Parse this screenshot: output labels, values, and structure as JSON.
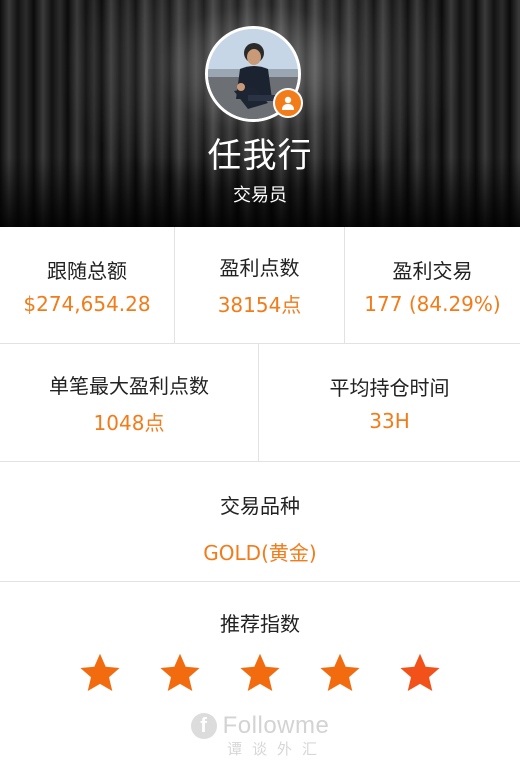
{
  "profile": {
    "name": "任我行",
    "role": "交易员"
  },
  "stats": [
    {
      "label": "跟随总额",
      "value": "$274,654.28"
    },
    {
      "label": "盈利点数",
      "value": "38154点"
    },
    {
      "label": "盈利交易",
      "value": "177 (84.29%)"
    }
  ],
  "stats2": [
    {
      "label": "单笔最大盈利点数",
      "value": "1048点"
    },
    {
      "label": "平均持仓时间",
      "value": "33H"
    }
  ],
  "variety": {
    "label": "交易品种",
    "value": "GOLD(黄金)"
  },
  "rating": {
    "label": "推荐指数",
    "stars": 5,
    "star_color": "#f26b0f"
  },
  "logo": {
    "brand": "Followme",
    "sub": "谭谈外汇"
  },
  "colors": {
    "accent": "#f27b1a",
    "divider": "#e2e2e2"
  }
}
